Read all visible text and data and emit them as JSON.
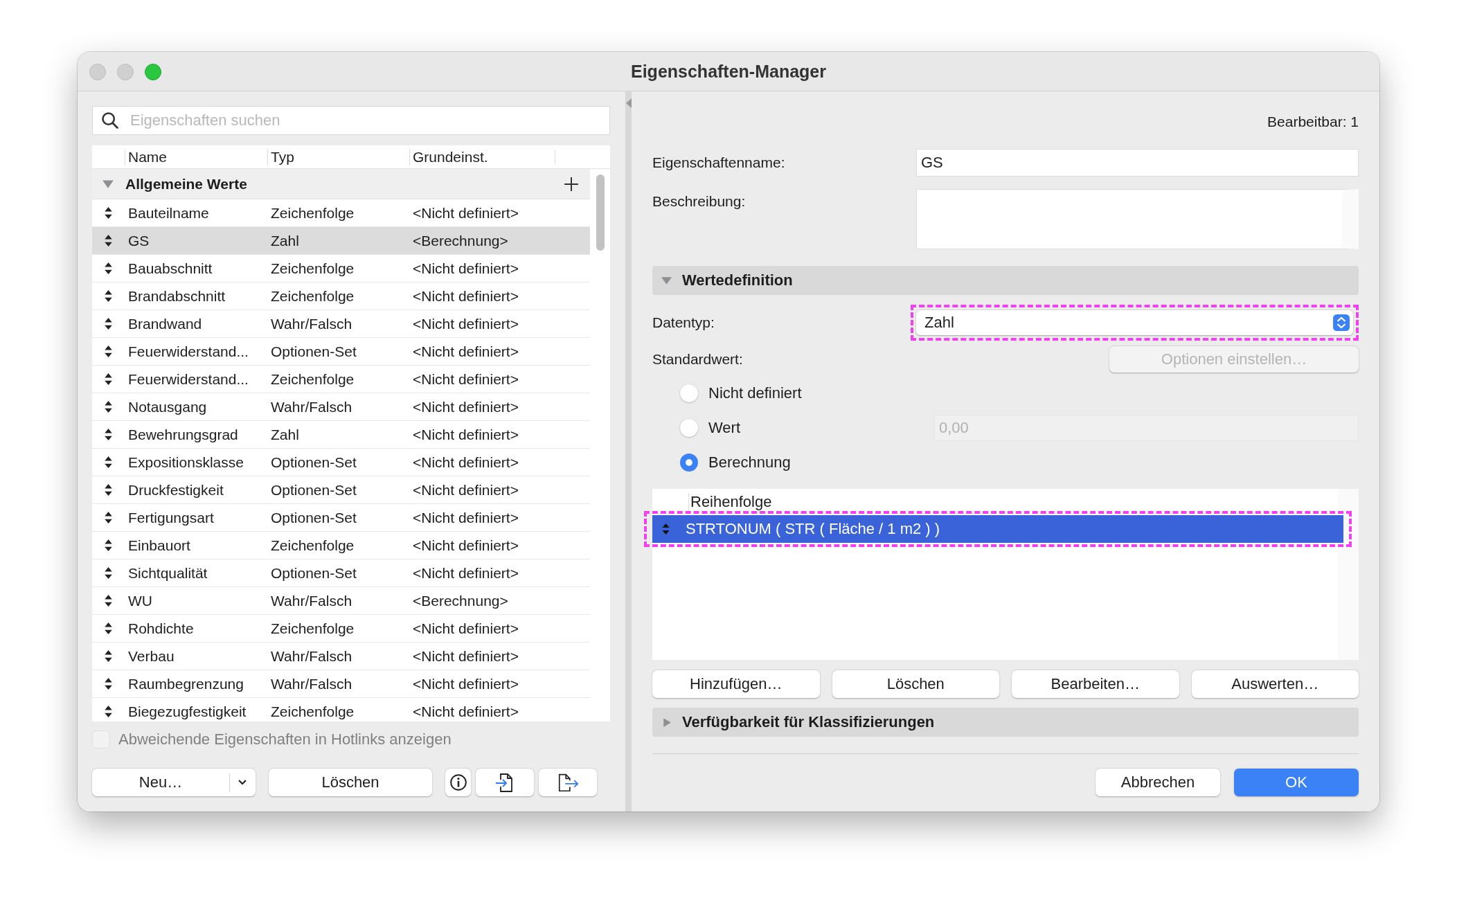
{
  "window": {
    "title": "Eigenschaften-Manager"
  },
  "search": {
    "placeholder": "Eigenschaften suchen"
  },
  "table": {
    "columns": [
      "Name",
      "Typ",
      "Grundeinst."
    ],
    "group": {
      "label": "Allgemeine Werte",
      "expanded": true
    },
    "rows": [
      {
        "name": "Bauteilname",
        "type": "Zeichenfolge",
        "default": "<Nicht definiert>",
        "selected": false
      },
      {
        "name": "GS",
        "type": "Zahl",
        "default": "<Berechnung>",
        "selected": true
      },
      {
        "name": "Bauabschnitt",
        "type": "Zeichenfolge",
        "default": "<Nicht definiert>",
        "selected": false
      },
      {
        "name": "Brandabschnitt",
        "type": "Zeichenfolge",
        "default": "<Nicht definiert>",
        "selected": false
      },
      {
        "name": "Brandwand",
        "type": "Wahr/Falsch",
        "default": "<Nicht definiert>",
        "selected": false
      },
      {
        "name": "Feuerwiderstand...",
        "type": "Optionen-Set",
        "default": "<Nicht definiert>",
        "selected": false
      },
      {
        "name": "Feuerwiderstand...",
        "type": "Zeichenfolge",
        "default": "<Nicht definiert>",
        "selected": false
      },
      {
        "name": "Notausgang",
        "type": "Wahr/Falsch",
        "default": "<Nicht definiert>",
        "selected": false
      },
      {
        "name": "Bewehrungsgrad",
        "type": "Zahl",
        "default": "<Nicht definiert>",
        "selected": false
      },
      {
        "name": "Expositionsklasse",
        "type": "Optionen-Set",
        "default": "<Nicht definiert>",
        "selected": false
      },
      {
        "name": "Druckfestigkeit",
        "type": "Optionen-Set",
        "default": "<Nicht definiert>",
        "selected": false
      },
      {
        "name": "Fertigungsart",
        "type": "Optionen-Set",
        "default": "<Nicht definiert>",
        "selected": false
      },
      {
        "name": "Einbauort",
        "type": "Zeichenfolge",
        "default": "<Nicht definiert>",
        "selected": false
      },
      {
        "name": "Sichtqualität",
        "type": "Optionen-Set",
        "default": "<Nicht definiert>",
        "selected": false
      },
      {
        "name": "WU",
        "type": "Wahr/Falsch",
        "default": "<Berechnung>",
        "selected": false
      },
      {
        "name": "Rohdichte",
        "type": "Zeichenfolge",
        "default": "<Nicht definiert>",
        "selected": false
      },
      {
        "name": "Verbau",
        "type": "Wahr/Falsch",
        "default": "<Nicht definiert>",
        "selected": false
      },
      {
        "name": "Raumbegrenzung",
        "type": "Wahr/Falsch",
        "default": "<Nicht definiert>",
        "selected": false
      },
      {
        "name": "Biegezugfestigkeit",
        "type": "Zeichenfolge",
        "default": "<Nicht definiert>",
        "selected": false
      }
    ]
  },
  "hotlinks_checkbox": {
    "label": "Abweichende Eigenschaften in Hotlinks anzeigen",
    "checked": false,
    "disabled": true
  },
  "left_buttons": {
    "new": "Neu…",
    "delete": "Löschen"
  },
  "editable": "Bearbeitbar: 1",
  "name_field": {
    "label": "Eigenschaftenname:",
    "value": "GS"
  },
  "description_field": {
    "label": "Beschreibung:"
  },
  "value_section": {
    "label": "Wertedefinition",
    "expanded": true
  },
  "datatype": {
    "label": "Datentyp:",
    "value": "Zahl",
    "highlighted": true
  },
  "default_value": {
    "label": "Standardwert:"
  },
  "options_button": {
    "label": "Optionen einstellen…",
    "disabled": true
  },
  "radios": [
    {
      "label": "Nicht definiert",
      "selected": false
    },
    {
      "label": "Wert",
      "selected": false
    },
    {
      "label": "Berechnung",
      "selected": true
    }
  ],
  "value_field": {
    "value": "0,00",
    "disabled": true
  },
  "formula_table": {
    "column": "Reihenfolge",
    "rows": [
      {
        "text": "STRTONUM ( STR ( Fläche / 1 m2 ) )",
        "selected": true,
        "highlighted": true
      }
    ]
  },
  "formula_buttons": [
    "Hinzufügen…",
    "Löschen",
    "Bearbeiten…",
    "Auswerten…"
  ],
  "classification_section": {
    "label": "Verfügbarkeit für Klassifizierungen",
    "expanded": false
  },
  "footer_buttons": [
    {
      "label": "Abbrechen",
      "kind": "secondary"
    },
    {
      "label": "OK",
      "kind": "primary"
    }
  ]
}
